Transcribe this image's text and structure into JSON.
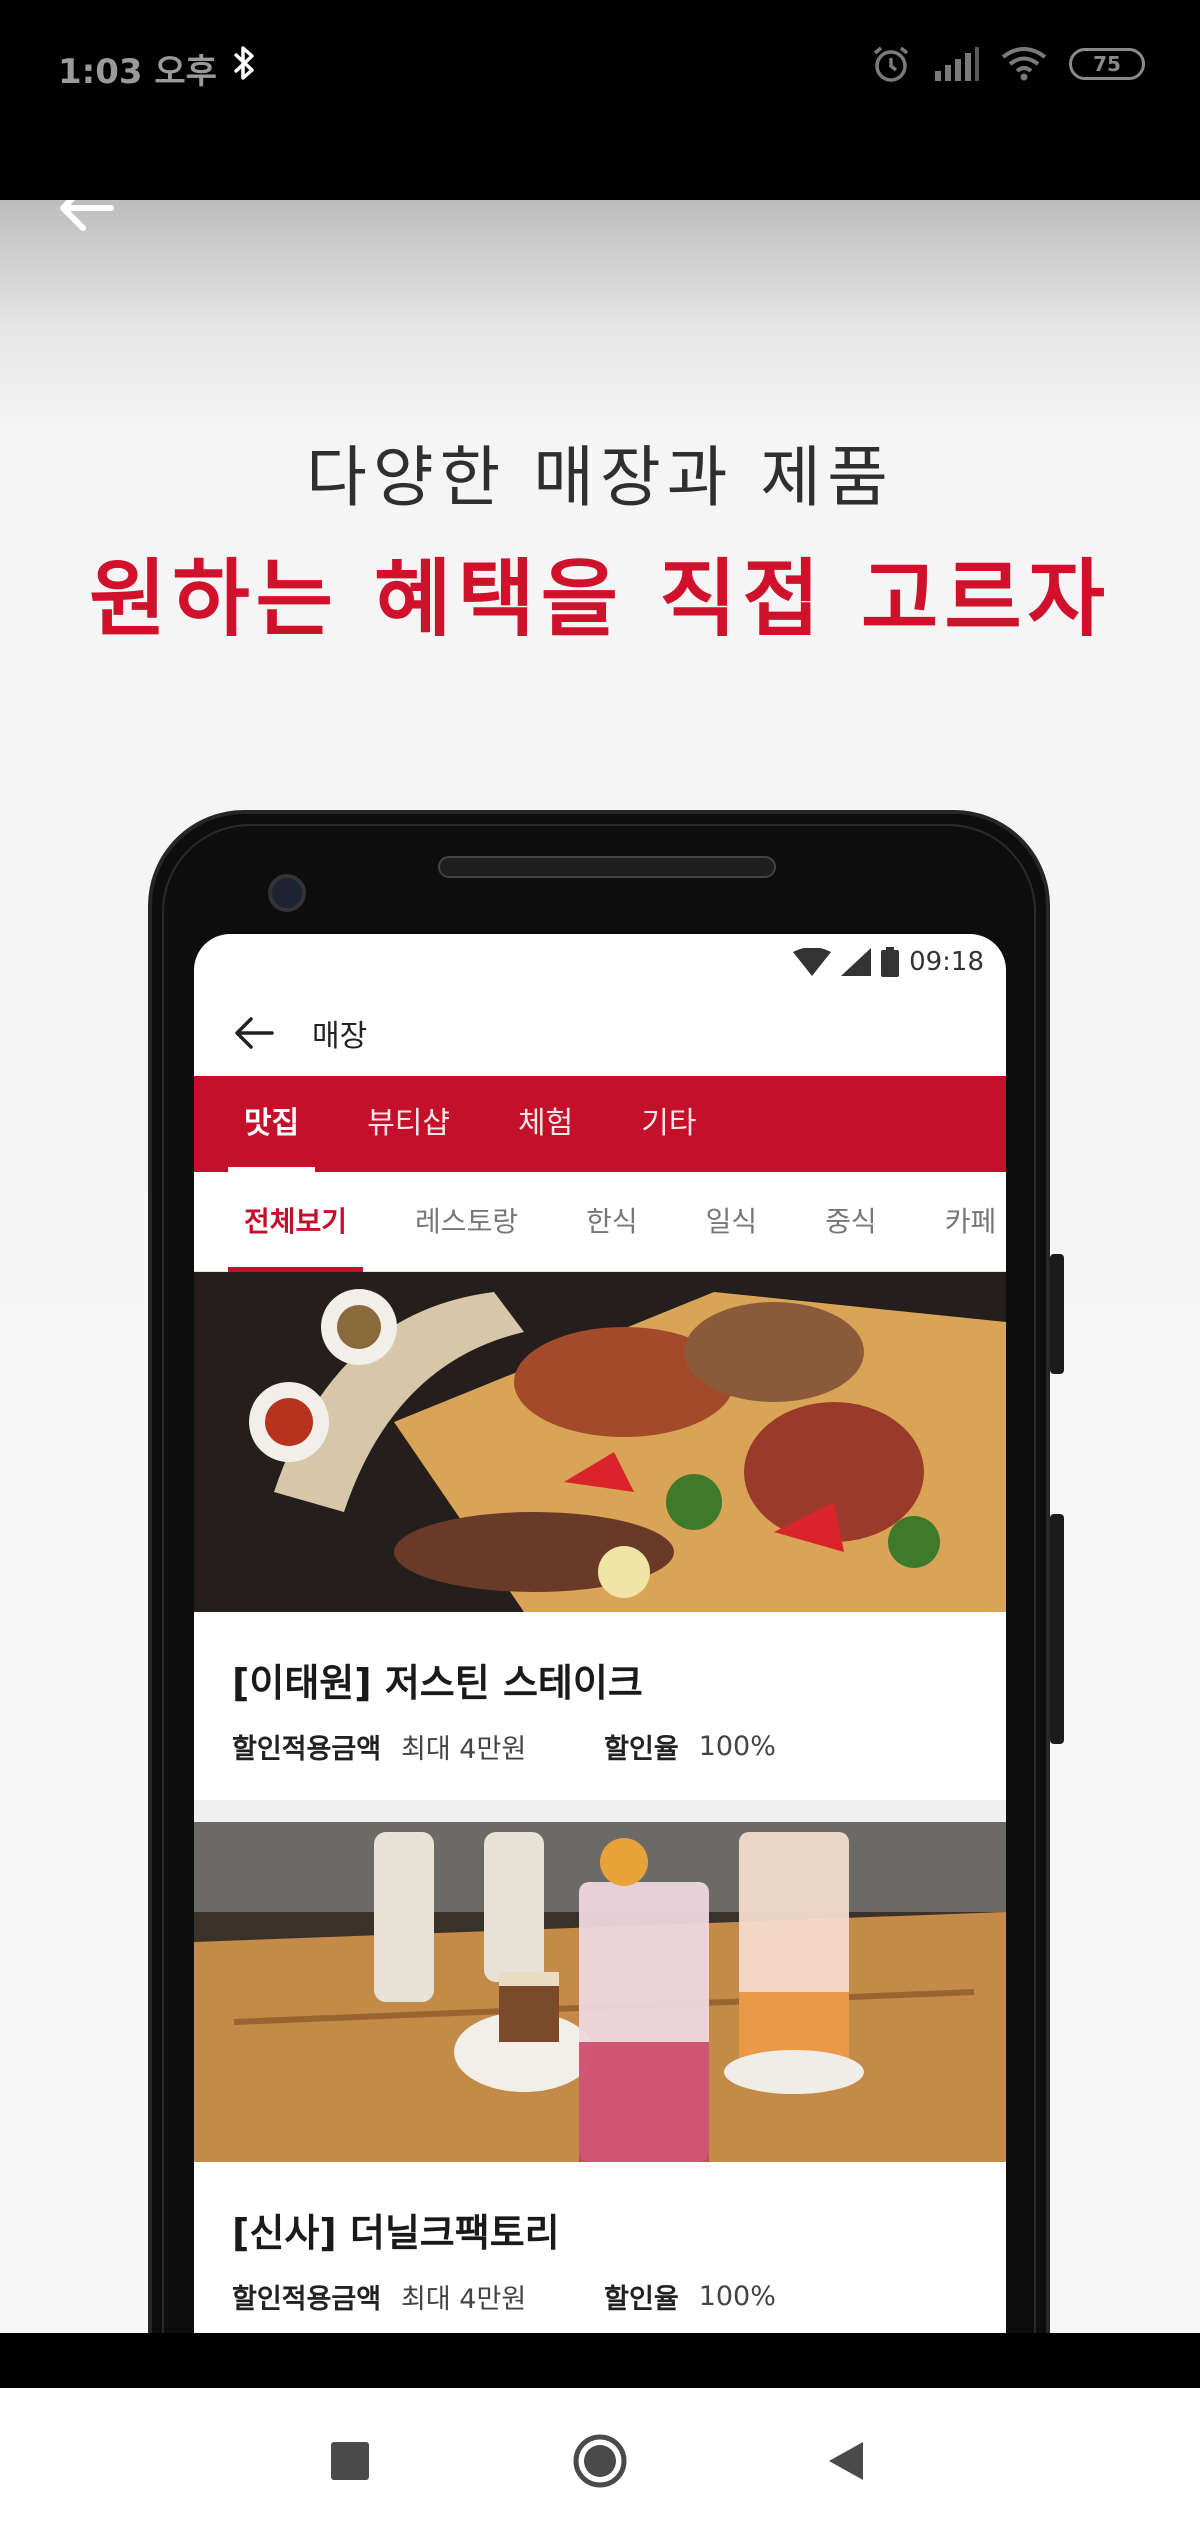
{
  "status_bar": {
    "time": "1:03 오후",
    "battery": "75",
    "icons": [
      "bluetooth-icon",
      "alarm-icon",
      "signal-icon",
      "wifi-icon",
      "battery-icon"
    ]
  },
  "promo": {
    "headline_line1": "다양한 매장과 제품",
    "headline_line2": "원하는 혜택을 직접 고르자",
    "accent_color": "#d0112b"
  },
  "device_screen": {
    "status_time": "09:18",
    "app_bar_title": "매장",
    "main_tabs": [
      {
        "label": "맛집",
        "active": true
      },
      {
        "label": "뷰티샵",
        "active": false
      },
      {
        "label": "체험",
        "active": false
      },
      {
        "label": "기타",
        "active": false
      }
    ],
    "sub_tabs": [
      {
        "label": "전체보기",
        "active": true
      },
      {
        "label": "레스토랑",
        "active": false
      },
      {
        "label": "한식",
        "active": false
      },
      {
        "label": "일식",
        "active": false
      },
      {
        "label": "중식",
        "active": false
      },
      {
        "label": "카페",
        "active": false
      }
    ],
    "cards": [
      {
        "title": "[이태원] 저스틴 스테이크",
        "discount_amount_label": "할인적용금액",
        "discount_amount_value": "최대 4만원",
        "discount_rate_label": "할인율",
        "discount_rate_value": "100%"
      },
      {
        "title": "[신사] 더닐크팩토리",
        "discount_amount_label": "할인적용금액",
        "discount_amount_value": "최대 4만원",
        "discount_rate_label": "할인율",
        "discount_rate_value": "100%"
      }
    ]
  },
  "nav_bar": {
    "buttons": [
      "recents-square-icon",
      "home-circle-icon",
      "back-triangle-icon"
    ]
  }
}
